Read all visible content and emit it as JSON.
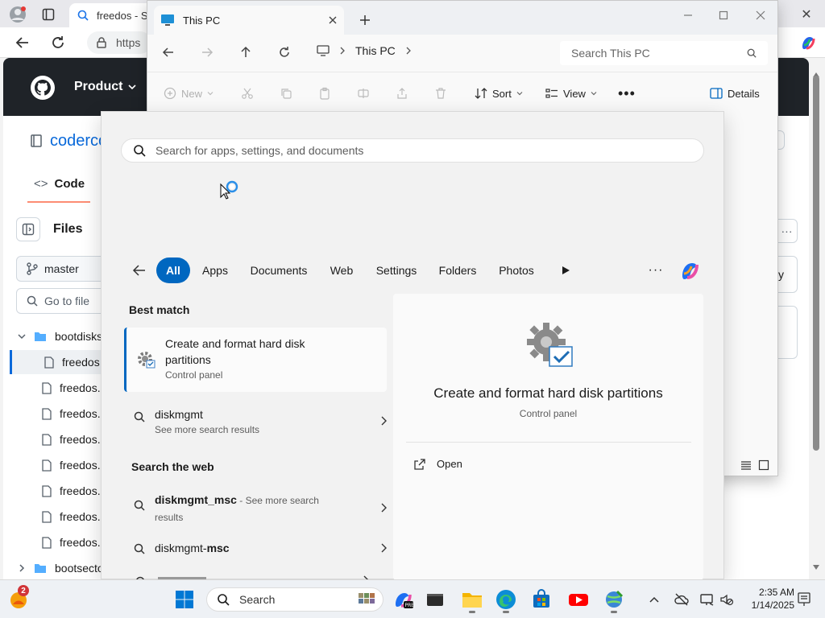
{
  "browser": {
    "tab_title": "freedos - Se",
    "url_text": "https",
    "close_label": "✕"
  },
  "github": {
    "product_label": "Product",
    "repo_name": "coderco",
    "code_tab": "Code",
    "files_heading": "Files",
    "branch": "master",
    "go_to_file": "Go to file",
    "tree": [
      {
        "label": "bootdisks",
        "kind": "folder"
      },
      {
        "label": "freedos.",
        "kind": "file",
        "selected": true
      },
      {
        "label": "freedos.",
        "kind": "file"
      },
      {
        "label": "freedos.",
        "kind": "file"
      },
      {
        "label": "freedos.",
        "kind": "file"
      },
      {
        "label": "freedos.",
        "kind": "file"
      },
      {
        "label": "freedos.",
        "kind": "file"
      },
      {
        "label": "freedos.",
        "kind": "file"
      },
      {
        "label": "freedos.",
        "kind": "file"
      },
      {
        "label": "bootsecto",
        "kind": "folder-collapsed"
      }
    ]
  },
  "explorer": {
    "tab_title": "This PC",
    "breadcrumb": "This PC",
    "search_placeholder": "Search This PC",
    "commands": {
      "new": "New",
      "sort": "Sort",
      "view": "View",
      "details": "Details"
    }
  },
  "search": {
    "placeholder": "Search for apps, settings, and documents",
    "chips": [
      "All",
      "Apps",
      "Documents",
      "Web",
      "Settings",
      "Folders",
      "Photos"
    ],
    "active_chip": "All",
    "best_match_heading": "Best match",
    "best_match": {
      "title": "Create and format hard disk partitions",
      "subtitle": "Control panel"
    },
    "suggestion": {
      "title": "diskmgmt",
      "subtitle": "See more search results"
    },
    "web_heading": "Search the web",
    "web_results": [
      {
        "bold": "diskmgmt_msc",
        "rest": " - See more search results"
      },
      {
        "prefix": "diskmgmt-",
        "bold": "msc",
        "rest": ""
      }
    ],
    "detail": {
      "title": "Create and format hard disk partitions",
      "subtitle": "Control panel",
      "action": "Open"
    }
  },
  "taskbar": {
    "search_label": "Search",
    "badge_count": "2",
    "time": "2:35 AM",
    "date": "1/14/2025"
  },
  "colors": {
    "accent": "#0067c0",
    "github_header": "#1f2328",
    "github_link": "#0969da"
  }
}
